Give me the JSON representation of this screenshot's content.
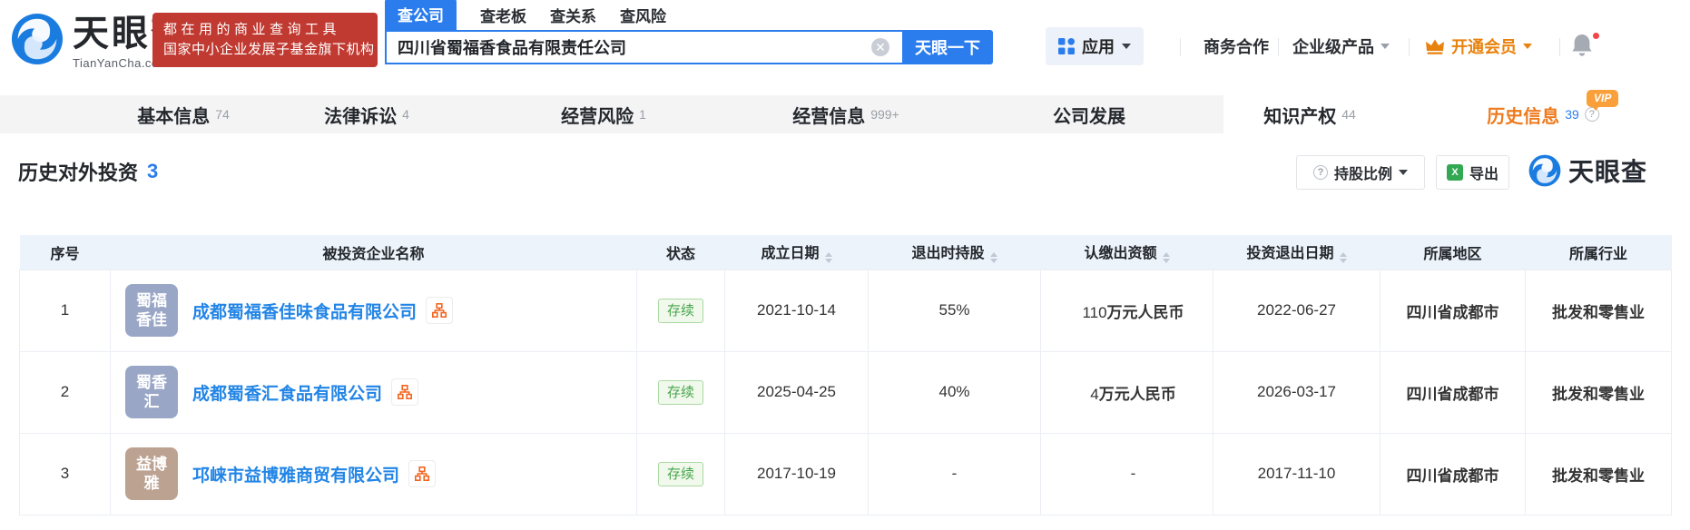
{
  "brand": {
    "logo_text": "天眼查",
    "logo_sub": "TianYanCha.com",
    "banner_line1": "都在用的商业查询工具",
    "banner_line2": "国家中小企业发展子基金旗下机构"
  },
  "search": {
    "tabs": [
      {
        "label": "查公司"
      },
      {
        "label": "查老板"
      },
      {
        "label": "查关系"
      },
      {
        "label": "查风险"
      }
    ],
    "query": "四川省蜀福香食品有限责任公司",
    "submit_label": "天眼一下"
  },
  "header_menu": {
    "apps_label": "应用",
    "biz_label": "商务合作",
    "enterprise_label": "企业级产品",
    "vip_label": "开通会员"
  },
  "nav_tabs": [
    {
      "label": "基本信息",
      "count": "74"
    },
    {
      "label": "法律诉讼",
      "count": "4"
    },
    {
      "label": "经营风险",
      "count": "1"
    },
    {
      "label": "经营信息",
      "count": "999+"
    },
    {
      "label": "公司发展",
      "count": ""
    },
    {
      "label": "知识产权",
      "count": "44"
    },
    {
      "label": "历史信息",
      "count": "39",
      "vip_badge": "VIP"
    }
  ],
  "section": {
    "title": "历史对外投资",
    "count": "3",
    "holding_button": "持股比例",
    "export_button": "导出",
    "watermark": "天眼查"
  },
  "table": {
    "columns": [
      {
        "label": "序号",
        "sortable": false
      },
      {
        "label": "被投资企业名称",
        "sortable": false
      },
      {
        "label": "状态",
        "sortable": false
      },
      {
        "label": "成立日期",
        "sortable": true
      },
      {
        "label": "退出时持股",
        "sortable": true
      },
      {
        "label": "认缴出资额",
        "sortable": true
      },
      {
        "label": "投资退出日期",
        "sortable": true
      },
      {
        "label": "所属地区",
        "sortable": false
      },
      {
        "label": "所属行业",
        "sortable": false
      }
    ],
    "rows": [
      {
        "no": "1",
        "avatar_line1": "蜀福",
        "avatar_line2": "香佳",
        "avatar_color": "#99a6c6",
        "name": "成都蜀福香佳味食品有限公司",
        "status": "存续",
        "established": "2021-10-14",
        "exit_holding": "55%",
        "capital_num": "110",
        "capital_unit": "万元人民币",
        "exit_date": "2022-06-27",
        "region": "四川省成都市",
        "industry": "批发和零售业"
      },
      {
        "no": "2",
        "avatar_line1": "蜀香",
        "avatar_line2": "汇",
        "avatar_color": "#99a6c6",
        "name": "成都蜀香汇食品有限公司",
        "status": "存续",
        "established": "2025-04-25",
        "exit_holding": "40%",
        "capital_num": "4",
        "capital_unit": "万元人民币",
        "exit_date": "2026-03-17",
        "region": "四川省成都市",
        "industry": "批发和零售业"
      },
      {
        "no": "3",
        "avatar_line1": "益博",
        "avatar_line2": "雅",
        "avatar_color": "#bca291",
        "name": "邛崃市益博雅商贸有限公司",
        "status": "存续",
        "established": "2017-10-19",
        "exit_holding": "-",
        "capital_num": "-",
        "capital_unit": "",
        "exit_date": "2017-11-10",
        "region": "四川省成都市",
        "industry": "批发和零售业"
      }
    ]
  },
  "colors": {
    "brand_blue": "#2b7ded",
    "link_blue": "#2285e6",
    "banner_red": "#c03a31",
    "tab_orange": "#ee7b1e",
    "vip_orange": "#f9a03a",
    "status_green": "#48a54c",
    "table_header_bg": "#edf3fb"
  }
}
